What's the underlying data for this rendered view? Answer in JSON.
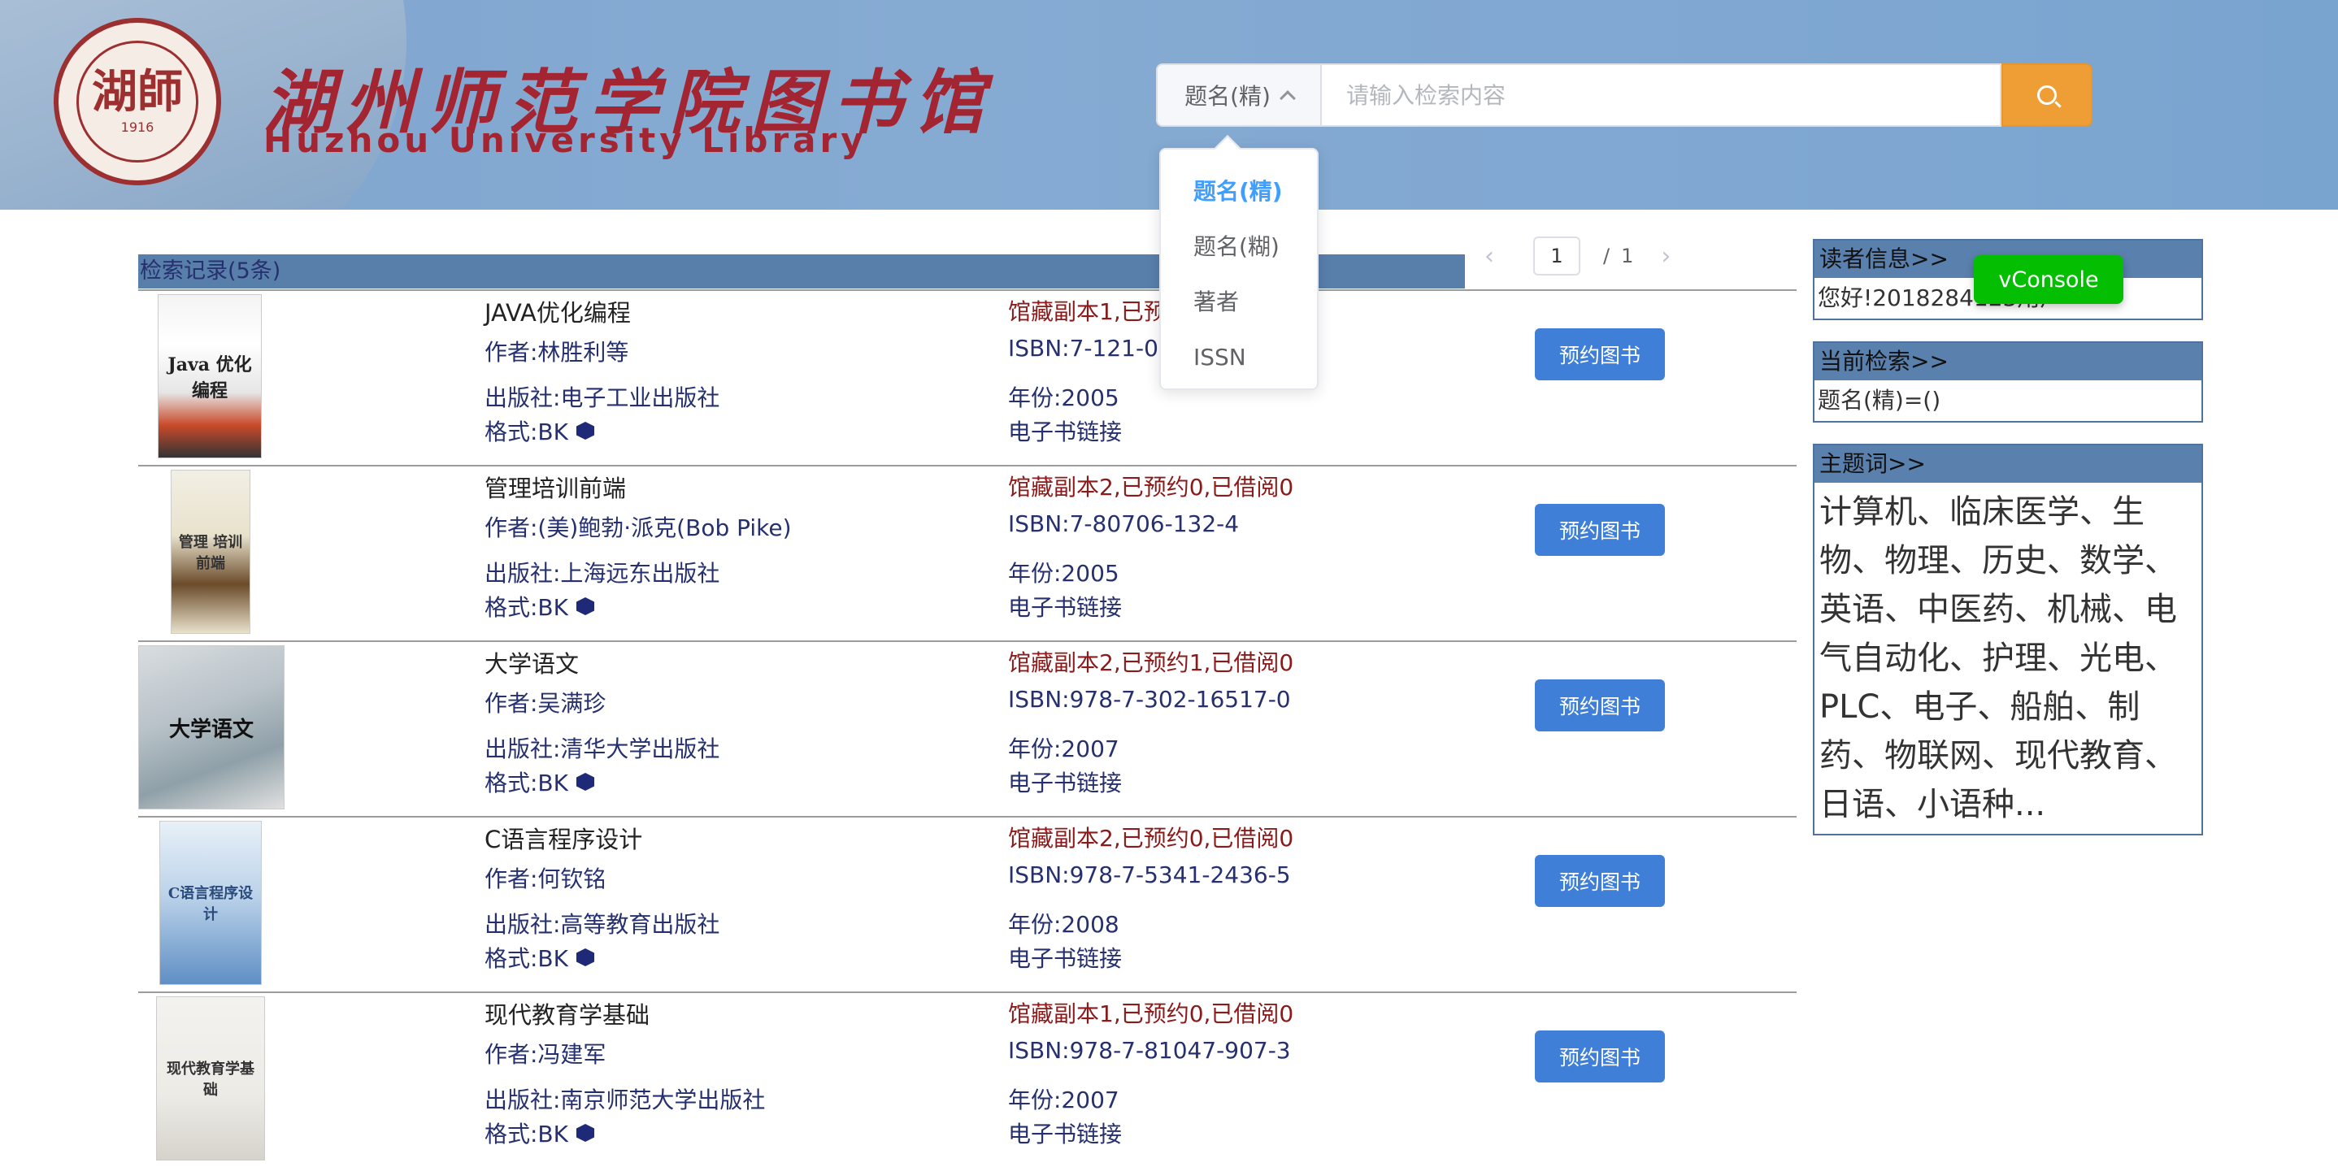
{
  "header": {
    "logo_cn": "湖州师范学院图书馆",
    "logo_en": "Huzhou University Library",
    "seal_glyph": "湖師",
    "seal_year": "1916"
  },
  "search": {
    "field_selected": "题名(精)",
    "placeholder": "请输入检索内容",
    "options": [
      "题名(精)",
      "题名(糊)",
      "著者",
      "ISSN"
    ],
    "accent_color": "#ee9e34"
  },
  "results": {
    "bar_label": "检索记录(5条)",
    "page_current": "1",
    "page_sep": "/",
    "page_total": "1",
    "books": [
      {
        "title": "JAVA优化编程",
        "author": "作者:林胜利等",
        "publisher": "出版社:电子工业出版社",
        "format": "格式:BK",
        "holdings": "馆藏副本1,已预",
        "isbn": "ISBN:7-121-01",
        "year": "年份:2005",
        "ebook": "电子书链接",
        "button": "预约图书",
        "cover_text": "Java 优化编程"
      },
      {
        "title": "管理培训前端",
        "author": "作者:(美)鲍勃·派克(Bob Pike)",
        "publisher": "出版社:上海远东出版社",
        "format": "格式:BK",
        "holdings": "馆藏副本2,已预约0,已借阅0",
        "isbn": "ISBN:7-80706-132-4",
        "year": "年份:2005",
        "ebook": "电子书链接",
        "button": "预约图书",
        "cover_text": "管理 培训前端"
      },
      {
        "title": "大学语文",
        "author": "作者:吴满珍",
        "publisher": "出版社:清华大学出版社",
        "format": "格式:BK",
        "holdings": "馆藏副本2,已预约1,已借阅0",
        "isbn": "ISBN:978-7-302-16517-0",
        "year": "年份:2007",
        "ebook": "电子书链接",
        "button": "预约图书",
        "cover_text": "大学语文"
      },
      {
        "title": "C语言程序设计",
        "author": "作者:何钦铭",
        "publisher": "出版社:高等教育出版社",
        "format": "格式:BK",
        "holdings": "馆藏副本2,已预约0,已借阅0",
        "isbn": "ISBN:978-7-5341-2436-5",
        "year": "年份:2008",
        "ebook": "电子书链接",
        "button": "预约图书",
        "cover_text": "C语言程序设计"
      },
      {
        "title": "现代教育学基础",
        "author": "作者:冯建军",
        "publisher": "出版社:南京师范大学出版社",
        "format": "格式:BK",
        "holdings": "馆藏副本1,已预约0,已借阅0",
        "isbn": "ISBN:978-7-81047-907-3",
        "year": "年份:2007",
        "ebook": "电子书链接",
        "button": "预约图书",
        "cover_text": "现代教育学基础"
      }
    ]
  },
  "sidebar": {
    "reader_header": "读者信息>>",
    "reader_body": "您好!2018284123用户",
    "current_header": "当前检索>>",
    "current_body": "题名(精)=()",
    "subject_header": "主题词>>",
    "subject_body": "计算机、临床医学、生物、物理、历史、数学、英语、中医药、机械、电气自动化、护理、光电、PLC、电子、船舶、制药、物联网、现代教育、日语、小语种..."
  },
  "vconsole": {
    "label": "vConsole"
  }
}
